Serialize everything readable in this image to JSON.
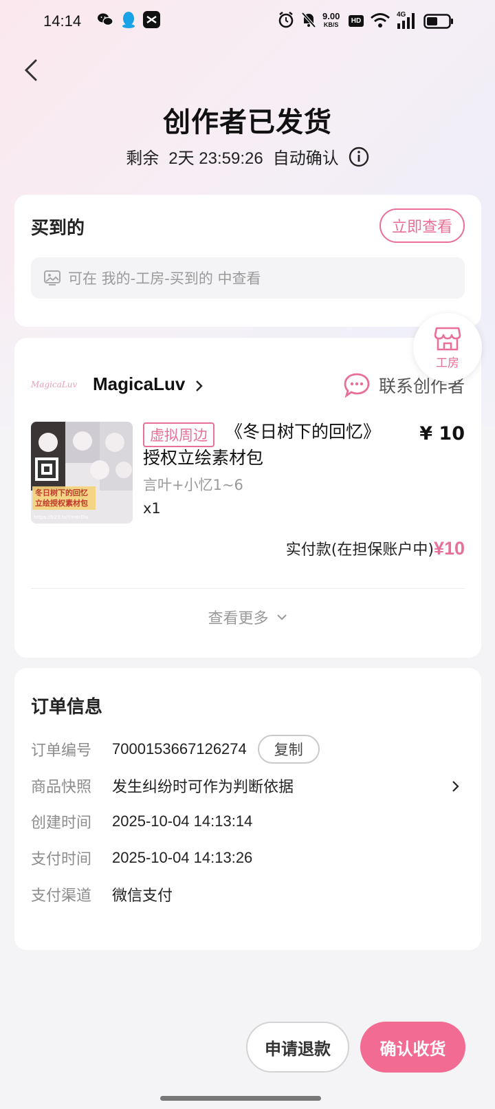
{
  "status_bar": {
    "time": "14:14",
    "net_speed_top": "9.00",
    "net_speed_bottom": "KB/S",
    "hd_label": "HD",
    "network_label": "4G",
    "icons": [
      "wechat-icon",
      "qq-icon",
      "capcut-icon",
      "alarm-icon",
      "mute-icon",
      "wifi-icon",
      "signal-icon",
      "battery-icon"
    ]
  },
  "header": {
    "title": "创作者已发货",
    "countdown_prefix": "剩余",
    "countdown": "2天 23:59:26",
    "countdown_suffix": "自动确认"
  },
  "purchased": {
    "title": "买到的",
    "view_button": "立即查看",
    "hint": "可在 我的-工房-买到的 中查看"
  },
  "floating_shop": {
    "label": "工房"
  },
  "order_item": {
    "shop_logo_text": "MagicaLuv",
    "shop_name": "MagicaLuv",
    "contact_label": "联系创作者",
    "tag": "虚拟周边",
    "product_title": "《冬日树下的回忆》授权立绘素材包",
    "price": "¥ 10",
    "spec": "言叶+小忆1~6",
    "quantity": "x1",
    "image_caption_line1": "冬日树下的回忆",
    "image_caption_line2": "立绘授权素材包",
    "image_url_text": "https://b23.tv/Ym8rDis",
    "paid_label": "实付款(在担保账户中)",
    "paid_amount": "¥10",
    "more_label": "查看更多"
  },
  "order_info": {
    "title": "订单信息",
    "rows": [
      {
        "label": "订单编号",
        "value": "7000153667126274"
      },
      {
        "label": "商品快照",
        "value": "发生纠纷时可作为判断依据"
      },
      {
        "label": "创建时间",
        "value": "2025-10-04 14:13:14"
      },
      {
        "label": "支付时间",
        "value": "2025-10-04 14:13:26"
      },
      {
        "label": "支付渠道",
        "value": "微信支付"
      }
    ],
    "copy_button": "复制"
  },
  "actions": {
    "refund": "申请退款",
    "confirm": "确认收货"
  },
  "colors": {
    "accent": "#f26b92",
    "accent_text": "#e86f96"
  }
}
